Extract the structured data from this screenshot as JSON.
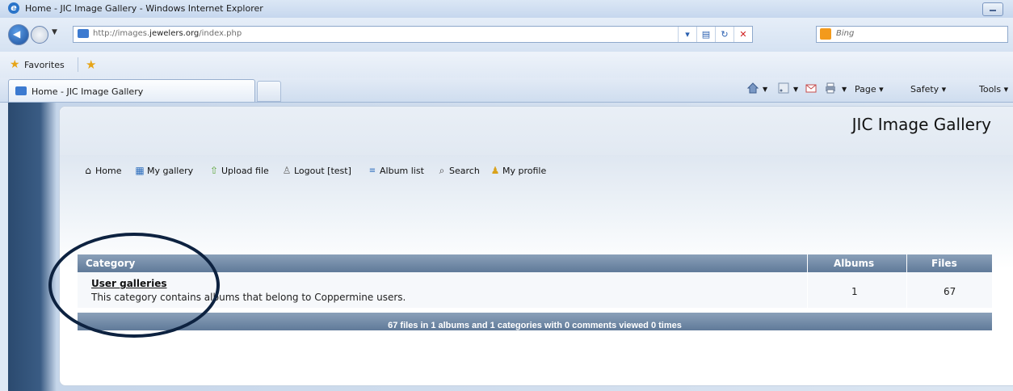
{
  "window": {
    "title": "Home - JIC Image Gallery - Windows Internet Explorer"
  },
  "address_bar": {
    "url_prefix": "http://images.",
    "url_domain": "jewelers.org",
    "url_suffix": "/index.php",
    "search_placeholder": "Bing"
  },
  "favorites_bar": {
    "label": "Favorites"
  },
  "tab": {
    "label": "Home - JIC Image Gallery"
  },
  "command_bar": {
    "page": "Page ▾",
    "safety": "Safety ▾",
    "tools": "Tools ▾"
  },
  "gallery": {
    "title": "JIC Image Gallery",
    "menu": [
      "Home",
      "My gallery",
      "Upload file",
      "Logout [test]",
      "Album list",
      "Search",
      "My profile"
    ]
  },
  "table": {
    "headers": {
      "category": "Category",
      "albums": "Albums",
      "files": "Files"
    },
    "rows": [
      {
        "name": "User galleries",
        "description": "This category contains albums that belong to Coppermine users.",
        "albums": "1",
        "files": "67"
      }
    ],
    "footer": "67 files in 1 albums and 1 categories with 0 comments viewed 0 times"
  },
  "colors": {
    "accent": "#607a99",
    "annotation_circle": "#0d2240"
  }
}
